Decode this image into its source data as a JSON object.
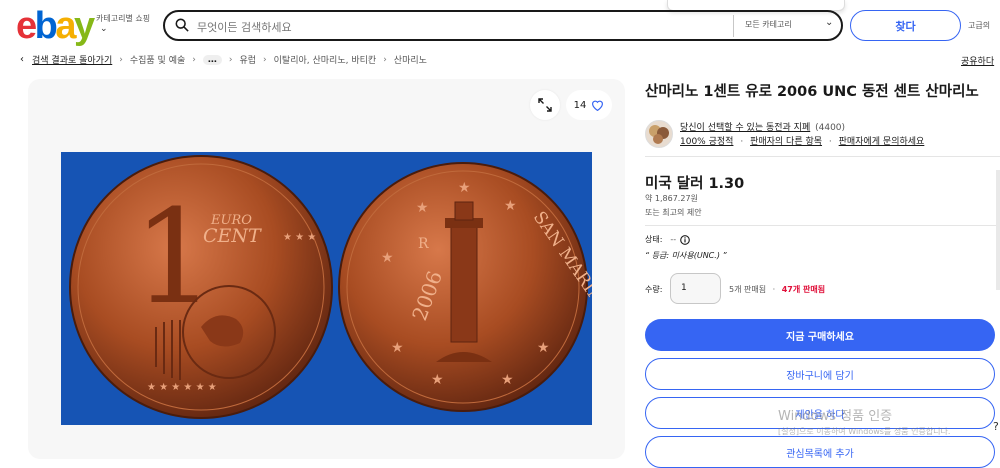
{
  "header": {
    "logo": {
      "e": "e",
      "b": "b",
      "a": "a",
      "y": "y"
    },
    "category_button": "카테고리별 쇼핑",
    "search_placeholder": "무엇이든 검색하세요",
    "category_select": "모든 카테고리",
    "search_button": "찾다",
    "advanced": "고급의"
  },
  "breadcrumb": {
    "back": "검색 결과로 돌아가기",
    "items": [
      "수집품 및 예술",
      "…",
      "유럽",
      "이탈리아, 산마리노, 바티칸",
      "산마리노"
    ],
    "share": "공유하다"
  },
  "gallery": {
    "watch_count": "14",
    "coin_left": {
      "top": "EURO",
      "mid": "CENT",
      "digit": "1"
    },
    "coin_right": {
      "year": "2006",
      "country": "SAN MARINO",
      "mark": "R"
    }
  },
  "item": {
    "title": "산마리노 1센트 유로 2006 UNC 동전 센트 산마리노",
    "seller_name": "당신이 선택할 수 있는 동전과 지폐",
    "seller_count": "(4400)",
    "positive": "100% 긍정적",
    "other_items": "판매자의 다른 항목",
    "contact": "판매자에게 문의하세요",
    "price": "미국 달러 1.30",
    "approx": "약 1,867.27원",
    "best_offer": "또는 최고의 제안",
    "condition_label": "상태:",
    "condition_value": "--",
    "grade": "“ 등급: 미사용(UNC.) ”",
    "quantity_label": "수량:",
    "quantity_value": "1",
    "available": "5개 판매됨",
    "sold": "47개 판매됨"
  },
  "actions": {
    "buy": "지금 구매하세요",
    "cart": "장바구니에 담기",
    "offer": "제안을 하다",
    "watch": "관심목록에 추가"
  },
  "watermark": {
    "line1": "Windows 정품 인증",
    "line2": "[설정]으로 이동하여 Windows를 정품 인증합니다."
  },
  "colors": {
    "accent": "#3665f3",
    "sold": "#e0103a",
    "photo_bg": "#1654b4",
    "coin": "#a84c22"
  }
}
